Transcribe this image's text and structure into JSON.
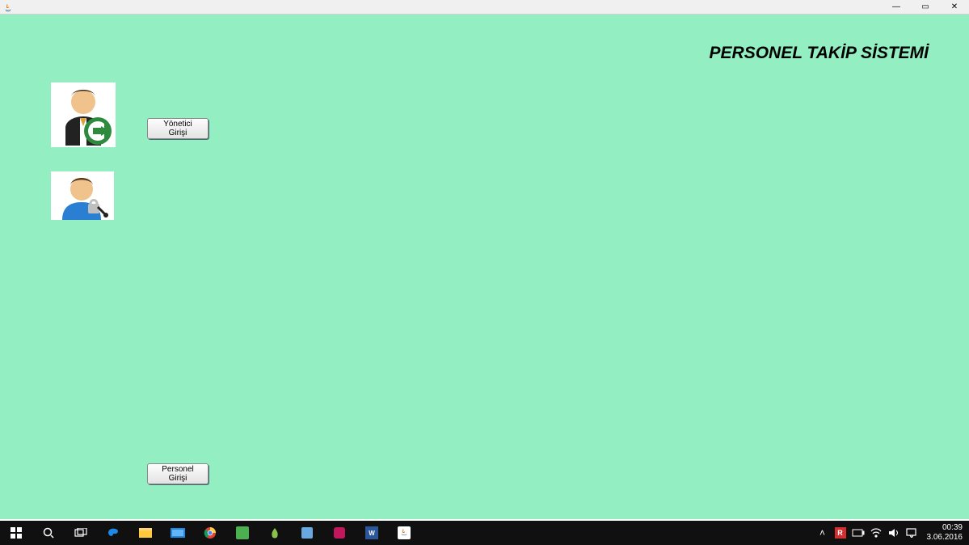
{
  "window": {
    "minimize": "—",
    "maximize": "▭",
    "close": "✕"
  },
  "app": {
    "title": "PERSONEL TAKİP SİSTEMİ",
    "admin_button": "Yönetici Girişi",
    "personnel_button": "Personel Girişi"
  },
  "taskbar": {
    "word_label": "W",
    "avira_label": "R",
    "tray_chevron": "˄",
    "clock_time": "00:39",
    "clock_date": "3.06.2016"
  }
}
